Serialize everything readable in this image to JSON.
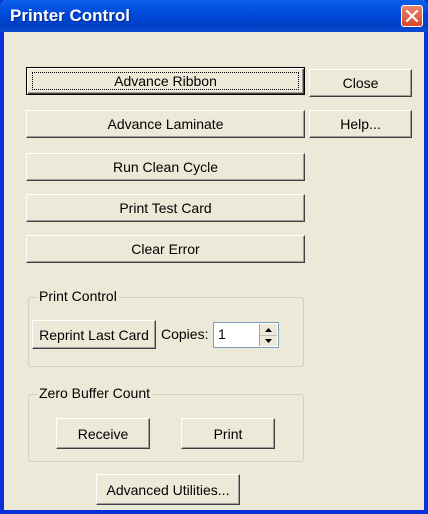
{
  "window": {
    "title": "Printer Control"
  },
  "buttons": {
    "advance_ribbon": "Advance Ribbon",
    "advance_laminate": "Advance Laminate",
    "run_clean_cycle": "Run Clean Cycle",
    "print_test_card": "Print Test Card",
    "clear_error": "Clear Error",
    "close": "Close",
    "help": "Help...",
    "advanced_utilities": "Advanced Utilities..."
  },
  "print_control": {
    "title": "Print Control",
    "reprint_label": "Reprint Last Card",
    "copies_label": "Copies:",
    "copies_value": "1"
  },
  "zero_buffer": {
    "title": "Zero Buffer Count",
    "receive_label": "Receive",
    "print_label": "Print"
  },
  "icons": {
    "close": "close-x-icon",
    "spin_up": "arrow-up-icon",
    "spin_down": "arrow-down-icon"
  },
  "colors": {
    "titlebar": "#0048d9",
    "close_button": "#d64a2a",
    "dialog_face": "#ece9d8"
  }
}
